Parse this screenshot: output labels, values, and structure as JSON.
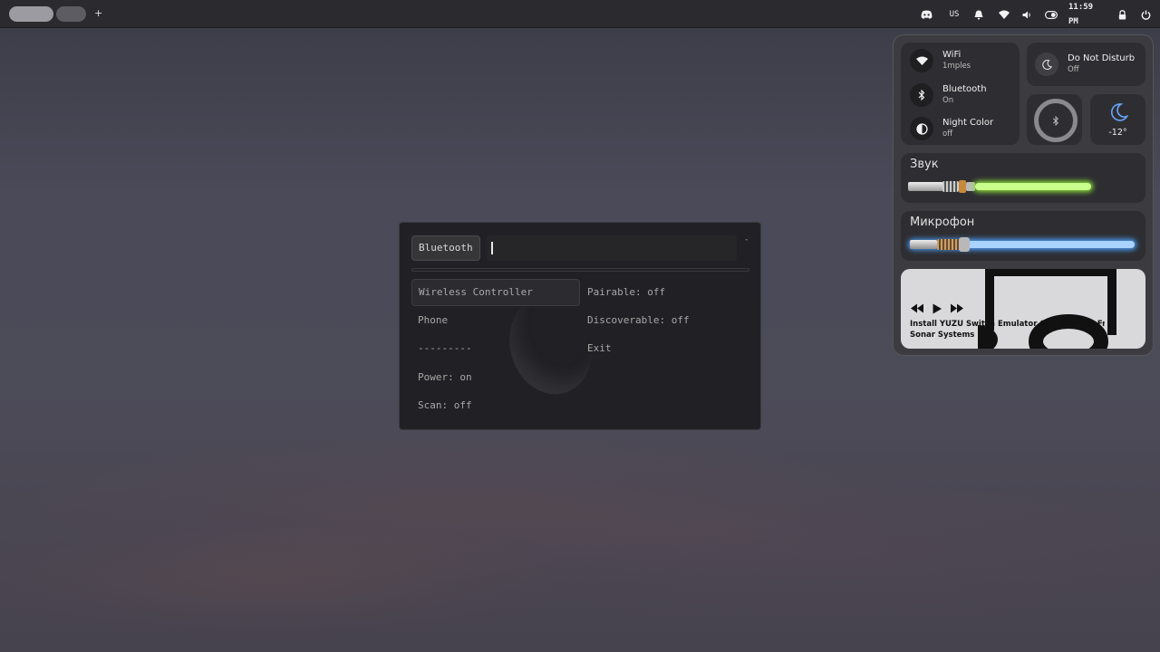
{
  "topbar": {
    "add_workspace_label": "+",
    "keyboard_layout": "US",
    "clock": "11:59 PM"
  },
  "bluetooth_menu": {
    "prompt": "Bluetooth",
    "mode_indicator": "-",
    "left_items": [
      "Wireless Controller",
      "Phone",
      "---------",
      "Power: on",
      "Scan: off"
    ],
    "right_items": [
      "Pairable: off",
      "Discoverable: off",
      "Exit"
    ],
    "selected_item": "Wireless Controller"
  },
  "control_center": {
    "wifi": {
      "title": "WiFi",
      "status": "1mples"
    },
    "bluetooth": {
      "title": "Bluetooth",
      "status": "On"
    },
    "night_color": {
      "title": "Night Color",
      "status": "off"
    },
    "dnd": {
      "title": "Do Not Disturb",
      "status": "Off"
    },
    "weather": {
      "temp": "-12°",
      "icon": "moon-icon"
    },
    "sound": {
      "title": "Звук",
      "level": 0.72,
      "color": "#8ee23a"
    },
    "mic": {
      "title": "Микрофон",
      "level": 1.0,
      "color": "#4aa0ff"
    },
    "media": {
      "title": "Install YUZU Switch Emulator On Linux For Fre...",
      "artist": "Sonar Systems"
    }
  },
  "colors": {
    "accent_weather": "#6aa6ff",
    "sound_blade": "#8ee23a",
    "mic_blade": "#4aa0ff"
  }
}
